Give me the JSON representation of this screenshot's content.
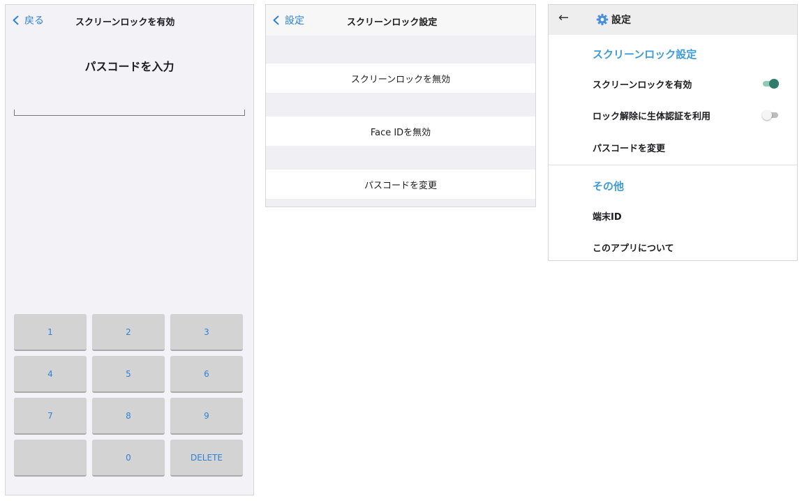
{
  "passcode_screen": {
    "back_label": "戻る",
    "title": "スクリーンロックを有効",
    "heading": "パスコードを入力",
    "keys": [
      "1",
      "2",
      "3",
      "4",
      "5",
      "6",
      "7",
      "8",
      "9",
      "",
      "0",
      "DELETE"
    ]
  },
  "ios_settings": {
    "back_label": "設定",
    "title": "スクリーンロック設定",
    "rows": [
      "スクリーンロックを無効",
      "Face IDを無効",
      "パスコードを変更"
    ]
  },
  "android_settings": {
    "title": "設定",
    "sections": [
      {
        "title": "スクリーンロック設定",
        "items": [
          {
            "label": "スクリーンロックを有効",
            "toggle": true
          },
          {
            "label": "ロック解除に生体認証を利用",
            "toggle": false
          },
          {
            "label": "パスコードを変更"
          }
        ]
      },
      {
        "title": "その他",
        "items": [
          {
            "label": "端末ID"
          },
          {
            "label": "このアプリについて"
          }
        ]
      }
    ]
  },
  "colors": {
    "ios_accent": "#2f80d6",
    "android_accent": "#3d9bd6",
    "toggle_on": "#2e7d6b",
    "keypad_key": "#d3d3d3"
  }
}
